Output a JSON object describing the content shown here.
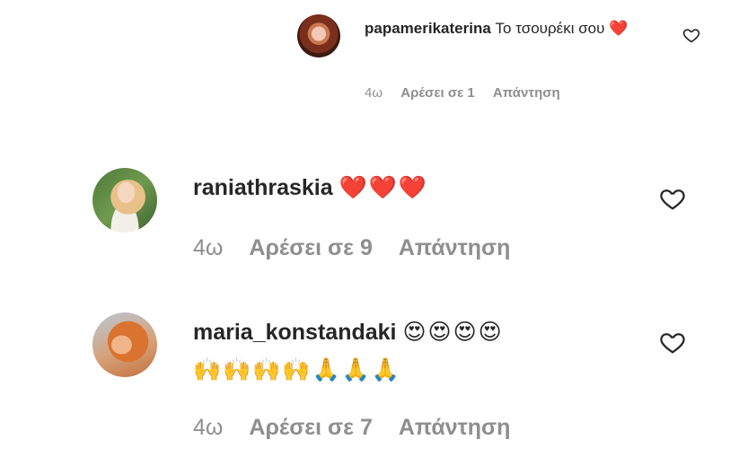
{
  "comments": [
    {
      "username": "papamerikaterina",
      "text": "Το τσουρέκι σου",
      "emoji": "❤️",
      "time": "4ω",
      "likes": "Αρέσει σε 1",
      "reply": "Απάντηση"
    },
    {
      "username": "raniathraskia",
      "text": "",
      "emoji": "❤️❤️❤️",
      "time": "4ω",
      "likes": "Αρέσει σε 9",
      "reply": "Απάντηση"
    },
    {
      "username": "maria_konstandaki",
      "text": "",
      "emoji": "😍😍😍😍",
      "emoji_line2": "🙌🙌🙌🙌🙏🙏🙏",
      "time": "4ω",
      "likes": "Αρέσει σε 7",
      "reply": "Απάντηση"
    }
  ],
  "icons": {
    "like": "heart-outline-icon"
  },
  "colors": {
    "text": "#262626",
    "meta": "#8e8e8e",
    "heart": "#e0162b"
  }
}
